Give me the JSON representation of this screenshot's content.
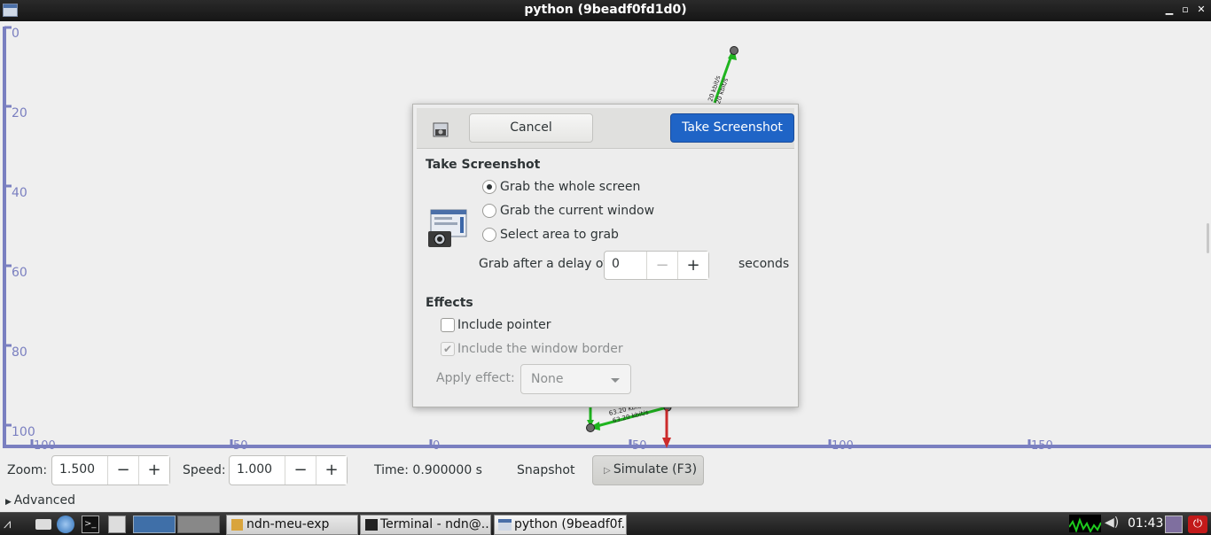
{
  "window": {
    "title": "python (9beadf0fd1d0)"
  },
  "canvas": {
    "y_ticks": [
      "0",
      "20",
      "40",
      "60",
      "80",
      "100"
    ],
    "x_ticks": [
      "100",
      "50",
      "0",
      "50",
      "100",
      "150"
    ],
    "link_top_a": "20 kbit/s",
    "link_top_b": "20 kbit/s",
    "link_bottom_a": "63.20 kbit/s",
    "link_bottom_b": "63.20 kbit/s"
  },
  "controls": {
    "zoom_label": "Zoom:",
    "zoom_value": "1.500",
    "speed_label": "Speed:",
    "speed_value": "1.000",
    "time": "Time: 0.900000 s",
    "snapshot": "Snapshot",
    "simulate": "Simulate (F3)",
    "advanced": "Advanced",
    "minus": "−",
    "plus": "+"
  },
  "dialog": {
    "cancel": "Cancel",
    "take": "Take Screenshot",
    "section_title": "Take Screenshot",
    "options": [
      "Grab the whole screen",
      "Grab the current window",
      "Select area to grab"
    ],
    "selected_option": 0,
    "delay_label": "Grab after a delay of",
    "delay_value": "0",
    "delay_unit": "seconds",
    "effects_title": "Effects",
    "include_pointer": "Include pointer",
    "include_border": "Include the window border",
    "apply_effect_label": "Apply effect:",
    "apply_effect_value": "None"
  },
  "taskbar": {
    "tasks": [
      "ndn-meu-exp",
      "Terminal - ndn@...",
      "python (9beadf0f..."
    ],
    "clock": "01:43"
  },
  "colors": {
    "axis": "#7a7fc0",
    "link_green": "#1fb51f",
    "link_red": "#cc2b2b",
    "accent": "#1f64c6"
  }
}
